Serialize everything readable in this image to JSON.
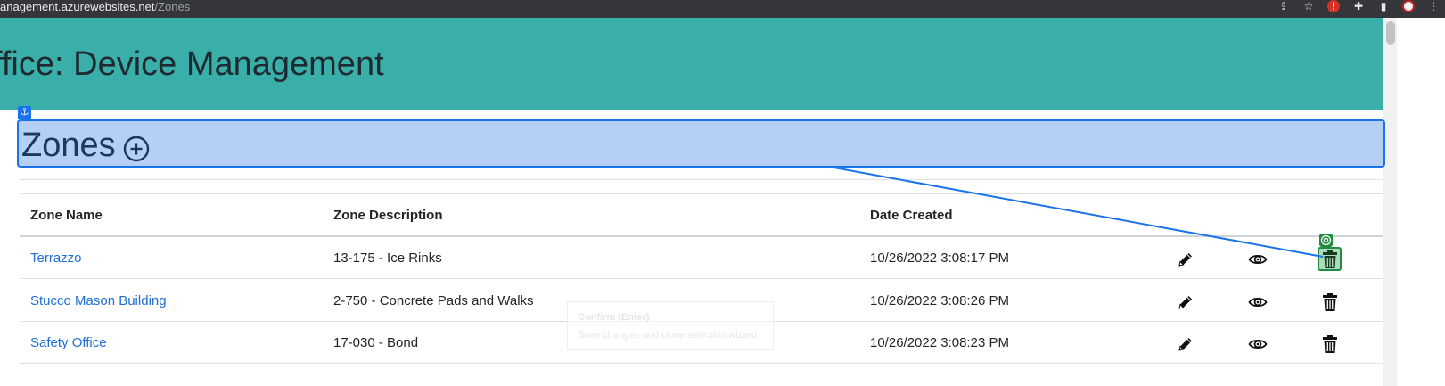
{
  "browser": {
    "url_host": "anagement.azurewebsites.net",
    "url_path": "/Zones"
  },
  "header": {
    "title": "ffice: Device Management"
  },
  "zones": {
    "title": "Zones"
  },
  "table": {
    "columns": [
      "Zone Name",
      "Zone Description",
      "Date Created"
    ],
    "rows": [
      {
        "name": "Terrazzo",
        "description": "13-175 - Ice Rinks",
        "date": "10/26/2022 3:08:17 PM"
      },
      {
        "name": "Stucco Mason Building",
        "description": "2-750 - Concrete Pads and Walks",
        "date": "10/26/2022 3:08:26 PM"
      },
      {
        "name": "Safety Office",
        "description": "17-030 - Bond",
        "date": "10/26/2022 3:08:23 PM"
      }
    ]
  },
  "tooltip": {
    "title": "Confirm (Enter)",
    "text": "Save changes and close selection wizard"
  },
  "colors": {
    "banner": "#3aafa9",
    "link": "#1f6fd1",
    "highlight_fill": "#b5cff5",
    "highlight_border": "#1a73e8",
    "target": "#1e8e3e"
  },
  "icons": {
    "add": "plus-circle-icon",
    "edit": "pencil-icon",
    "view": "eye-icon",
    "delete": "trash-icon",
    "anchor": "anchor-icon",
    "target": "target-icon"
  }
}
